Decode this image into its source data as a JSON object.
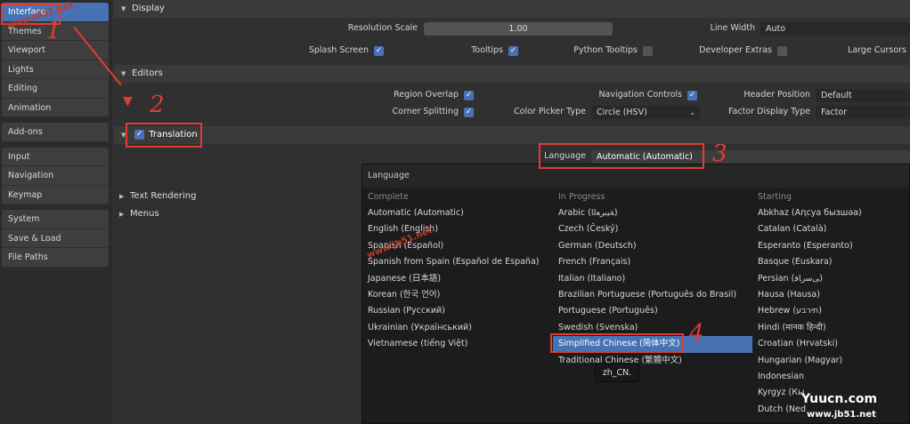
{
  "sidebar": {
    "groups": [
      [
        "Interface",
        "Themes",
        "Viewport",
        "Lights",
        "Editing",
        "Animation"
      ],
      [
        "Add-ons"
      ],
      [
        "Input",
        "Navigation",
        "Keymap"
      ],
      [
        "System",
        "Save & Load",
        "File Paths"
      ]
    ]
  },
  "display": {
    "header": "Display",
    "resolution_scale_label": "Resolution Scale",
    "resolution_scale_value": "1.00",
    "line_width_label": "Line Width",
    "line_width_value": "Auto",
    "splash_screen_label": "Splash Screen",
    "tooltips_label": "Tooltips",
    "python_tooltips_label": "Python Tooltips",
    "developer_extras_label": "Developer Extras",
    "large_cursors_label": "Large Cursors"
  },
  "editors": {
    "header": "Editors",
    "region_overlap_label": "Region Overlap",
    "navigation_controls_label": "Navigation Controls",
    "header_position_label": "Header Position",
    "header_position_value": "Default",
    "corner_splitting_label": "Corner Splitting",
    "color_picker_label": "Color Picker Type",
    "color_picker_value": "Circle (HSV)",
    "factor_display_label": "Factor Display Type",
    "factor_display_value": "Factor"
  },
  "translation": {
    "header": "Translation",
    "language_label": "Language",
    "language_value": "Automatic (Automatic)"
  },
  "collapsed": {
    "text_rendering": "Text Rendering",
    "menus": "Menus"
  },
  "menu": {
    "title": "Language",
    "complete_header": "Complete",
    "complete": [
      "Automatic (Automatic)",
      "English (English)",
      "Spanish (Español)",
      "Spanish from Spain (Español de España)",
      "Japanese (日本語)",
      "Korean (한국 언어)",
      "Russian (Русский)",
      "Ukrainian (Український)",
      "Vietnamese (tiếng Việt)"
    ],
    "progress_header": "In Progress",
    "progress": [
      "Arabic (ﺔﻴﺑﺮﻌﻟﺍ)",
      "Czech (Český)",
      "German (Deutsch)",
      "French (Français)",
      "Italian (Italiano)",
      "Brazilian Portuguese (Português do Brasil)",
      "Portuguese (Português)",
      "Swedish (Svenska)",
      "Simplified Chinese (简体中文)",
      "Traditional Chinese (繁體中文)"
    ],
    "starting_header": "Starting",
    "starting": [
      "Abkhaz (Аԥсуа бызшәа)",
      "Catalan (Català)",
      "Esperanto (Esperanto)",
      "Basque (Euskara)",
      "Persian (ﻰﺳﺭﺎﻓ)",
      "Hausa (Hausa)",
      "Hebrew (תירבע)",
      "Hindi (मानक हिन्दी)",
      "Croatian (Hrvatski)",
      "Hungarian (Magyar)",
      "Indonesian",
      "Kyrgyz (Кы",
      "Dutch (Ned"
    ]
  },
  "tooltip": "zh_CN.",
  "annotations": {
    "n1": "1",
    "n2": "2",
    "n3": "3",
    "n4": "4"
  },
  "watermarks": {
    "top": "www.jb51.net",
    "mid": "www.jb51.net",
    "yuucn": "Yuucn.com",
    "jb51": "www.jb51.net"
  },
  "colors": {
    "accent": "#4772b3",
    "annotation": "#e23b34"
  }
}
